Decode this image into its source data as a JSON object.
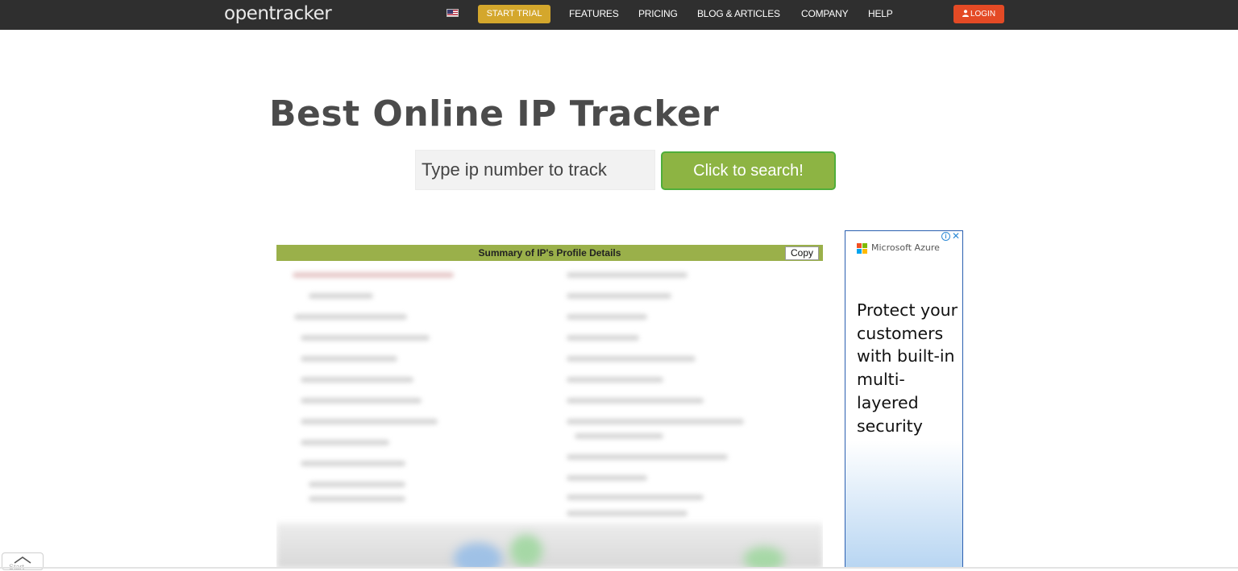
{
  "header": {
    "logo": "opentracker",
    "flag_icon": "us-flag-icon",
    "start_trial": "START TRIAL",
    "nav": [
      "FEATURES",
      "PRICING",
      "BLOG & ARTICLES",
      "COMPANY",
      "HELP"
    ],
    "login": "LOGIN",
    "colors": {
      "bar": "#2f2f2f",
      "trial": "#d4a72c",
      "login": "#e44a25"
    }
  },
  "main": {
    "title": "Best Online IP Tracker",
    "search": {
      "placeholder": "Type ip number to track",
      "button": "Click to search!",
      "button_color": "#8db443"
    },
    "summary": {
      "heading": "Summary of IP's Profile Details",
      "copy_button": "Copy",
      "header_color": "#9ab04a"
    }
  },
  "ad": {
    "brand": "Microsoft Azure",
    "text": "Protect your customers with built-in multi-layered security",
    "info_icon": "info-icon",
    "close_icon": "close-icon"
  },
  "footer": {
    "scroll_label": "Start"
  }
}
